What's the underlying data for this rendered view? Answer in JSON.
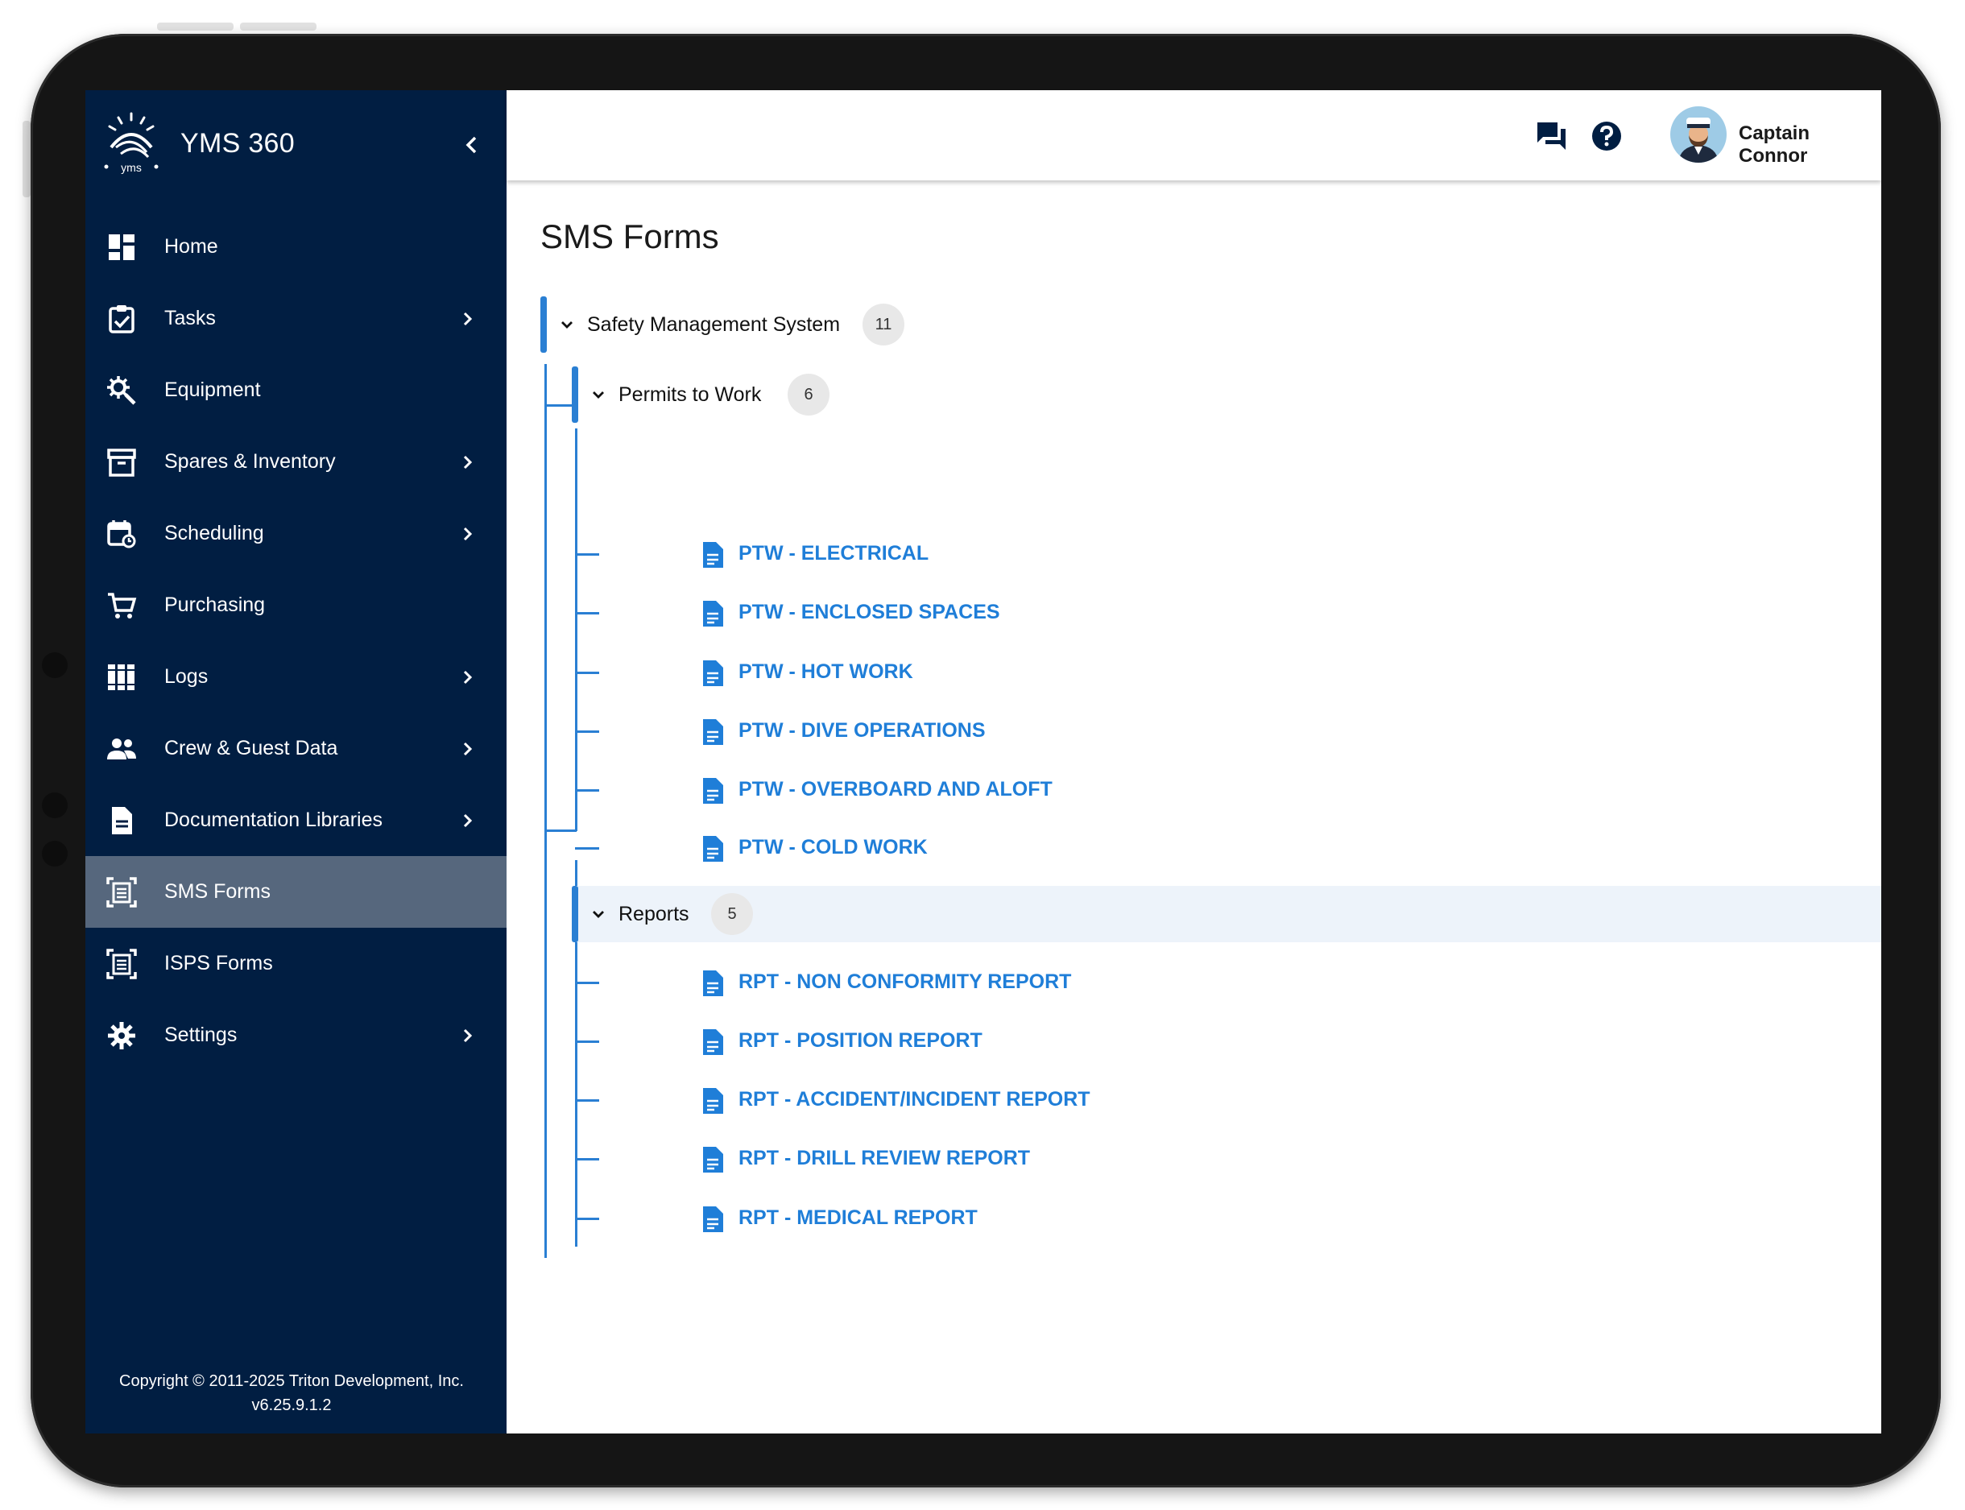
{
  "app": {
    "title": "YMS 360"
  },
  "sidebar": {
    "items": [
      {
        "label": "Home",
        "icon": "dashboard-icon",
        "has_submenu": false
      },
      {
        "label": "Tasks",
        "icon": "clipboard-check-icon",
        "has_submenu": true
      },
      {
        "label": "Equipment",
        "icon": "gear-search-icon",
        "has_submenu": false
      },
      {
        "label": "Spares & Inventory",
        "icon": "archive-box-icon",
        "has_submenu": true
      },
      {
        "label": "Scheduling",
        "icon": "calendar-refresh-icon",
        "has_submenu": true
      },
      {
        "label": "Purchasing",
        "icon": "shopping-cart-icon",
        "has_submenu": false
      },
      {
        "label": "Logs",
        "icon": "books-icon",
        "has_submenu": true
      },
      {
        "label": "Crew & Guest Data",
        "icon": "people-icon",
        "has_submenu": true
      },
      {
        "label": "Documentation Libraries",
        "icon": "document-icon",
        "has_submenu": true
      },
      {
        "label": "SMS Forms",
        "icon": "form-scan-icon",
        "has_submenu": false,
        "active": true
      },
      {
        "label": "ISPS Forms",
        "icon": "form-scan-icon",
        "has_submenu": false
      },
      {
        "label": "Settings",
        "icon": "gear-icon",
        "has_submenu": true
      }
    ],
    "copyright_line1": "Copyright © 2011-2025 Triton Development, Inc.",
    "version": "v6.25.9.1.2"
  },
  "header": {
    "user_name": "Captain Connor",
    "icons": [
      "chat-icon",
      "help-icon",
      "avatar"
    ]
  },
  "main": {
    "page_title": "SMS Forms",
    "tree": {
      "root": {
        "label": "Safety Management System",
        "count": "11"
      },
      "groups": [
        {
          "label": "Permits to Work",
          "count": "6",
          "items": [
            "PTW - ELECTRICAL",
            "PTW - ENCLOSED SPACES",
            "PTW - HOT WORK",
            "PTW - DIVE OPERATIONS",
            "PTW - OVERBOARD AND ALOFT",
            "PTW - COLD WORK"
          ]
        },
        {
          "label": "Reports",
          "count": "5",
          "highlighted": true,
          "items": [
            "RPT - NON CONFORMITY REPORT",
            "RPT - POSITION REPORT",
            "RPT - ACCIDENT/INCIDENT REPORT",
            "RPT - DRILL REVIEW REPORT",
            "RPT - MEDICAL REPORT"
          ]
        }
      ]
    }
  },
  "colors": {
    "sidebar": "#011e42",
    "active_item": "#56677d",
    "accent": "#2a7fd3",
    "link": "#1f7ed8"
  }
}
